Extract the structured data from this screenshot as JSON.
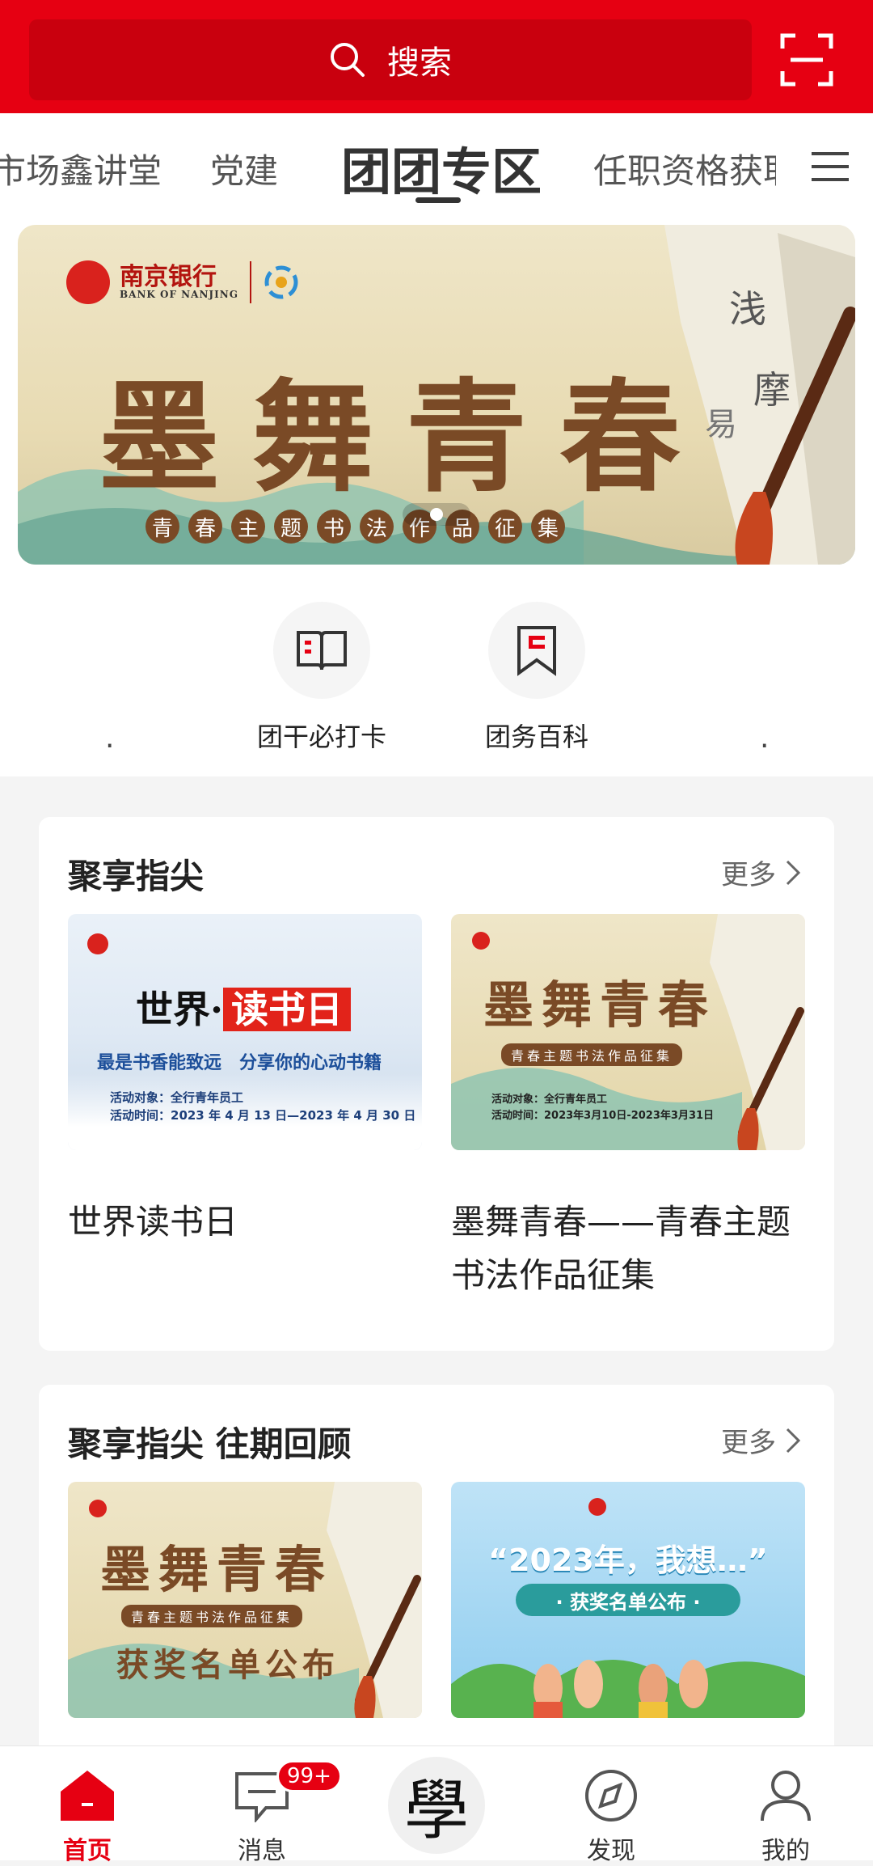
{
  "search": {
    "placeholder": "搜索"
  },
  "tabs": [
    "市场鑫讲堂",
    "党建",
    "团团专区",
    "任职资格获取"
  ],
  "banner": {
    "bank_name": "南京银行",
    "bank_name_en": "BANK OF NANJING",
    "title": "墨舞青春",
    "subtitle_chars": [
      "青",
      "春",
      "主",
      "题",
      "书",
      "法",
      "作",
      "品",
      "征",
      "集"
    ]
  },
  "quick_links": [
    {
      "label": "团干必打卡",
      "icon": "book-icon"
    },
    {
      "label": "团务百科",
      "icon": "bookmark-icon"
    }
  ],
  "quick_dots": [
    ".",
    "."
  ],
  "section1": {
    "title": "聚享指尖",
    "more": "更多",
    "items": [
      {
        "title": "世界读书日",
        "thumb": {
          "heading_a": "世界·",
          "heading_b": "读书日",
          "slogan": "最是书香能致远　分享你的心动书籍",
          "line1": "活动对象：全行青年员工",
          "line2": "活动时间：2023 年 4 月 13 日—2023 年 4 月 30 日"
        }
      },
      {
        "title": "墨舞青春——青春主题书法作品征集",
        "thumb": {
          "heading": "墨舞青春",
          "sub": "青春主题书法作品征集",
          "line1": "活动对象：全行青年员工",
          "line2": "活动时间：2023年3月10日-2023年3月31日"
        }
      }
    ]
  },
  "section2": {
    "title": "聚享指尖 往期回顾",
    "more": "更多",
    "items": [
      {
        "thumb": {
          "heading": "墨舞青春",
          "sub": "青春主题书法作品征集",
          "award": "获奖名单公布"
        }
      },
      {
        "thumb": {
          "heading": "“2023年，我想…”",
          "award": "· 获奖名单公布 ·"
        }
      }
    ]
  },
  "nav": {
    "items": [
      "首页",
      "消息",
      "發现",
      "我的"
    ],
    "labels": {
      "home": "首页",
      "messages": "消息",
      "discover": "发现",
      "me": "我的"
    },
    "badge": "99+",
    "center_glyph": "學"
  },
  "colors": {
    "brand": "#e60012",
    "ink": "#7a4a26"
  }
}
